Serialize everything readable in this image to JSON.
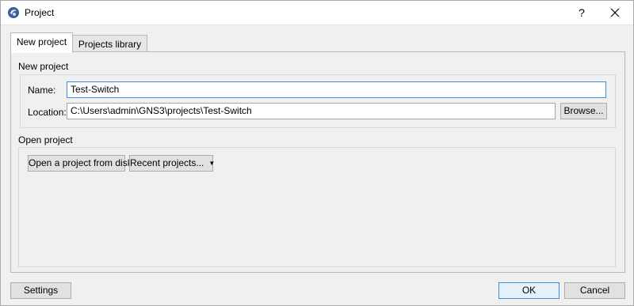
{
  "window": {
    "title": "Project",
    "help_label": "?"
  },
  "tabs": [
    {
      "label": "New project"
    },
    {
      "label": "Projects library"
    }
  ],
  "new_project": {
    "section_title": "New project",
    "name_label": "Name:",
    "name_value": "Test-Switch",
    "location_label": "Location:",
    "location_value": "C:\\Users\\admin\\GNS3\\projects\\Test-Switch",
    "browse_label": "Browse..."
  },
  "open_project": {
    "section_title": "Open project",
    "open_from_disk_label": "Open a project from disk",
    "recent_projects_label": "Recent projects..."
  },
  "footer": {
    "settings_label": "Settings",
    "ok_label": "OK",
    "cancel_label": "Cancel"
  },
  "colors": {
    "focus_accent": "#3c8ce0",
    "app_icon": "#3a5f96"
  }
}
